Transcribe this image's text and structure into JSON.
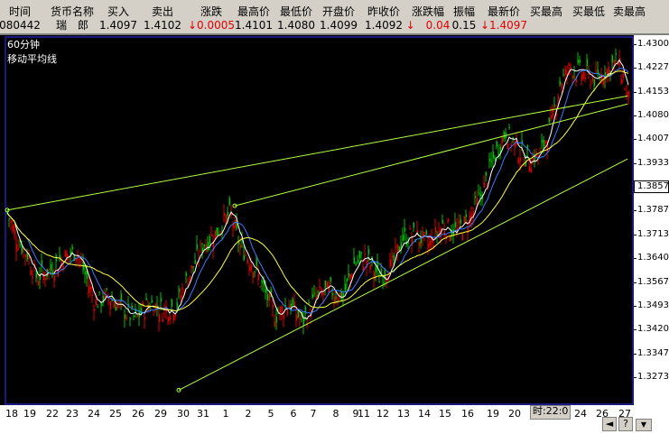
{
  "header": {
    "columns": [
      {
        "label": "时间",
        "value": "080442",
        "red": false
      },
      {
        "label": "货币名称",
        "value": "瑞　郎",
        "red": false
      },
      {
        "label": "买入",
        "value": "1.4097",
        "red": false
      },
      {
        "label": "卖出",
        "value": "1.4102",
        "red": false
      },
      {
        "label": "涨跌",
        "value": "↓0.0005",
        "red": true
      },
      {
        "label": "最高价",
        "value": "1.4101",
        "red": false
      },
      {
        "label": "最低价",
        "value": "1.4080",
        "red": false
      },
      {
        "label": "开盘价",
        "value": "1.4099",
        "red": false
      },
      {
        "label": "昨收价",
        "value": "1.4092",
        "red": false
      },
      {
        "label": "涨跌幅",
        "value": "↓　0.04",
        "red": true
      },
      {
        "label": "振幅",
        "value": "0.15",
        "red": false
      },
      {
        "label": "最新价",
        "value": "↓1.4097",
        "red": true
      },
      {
        "label": "买最高",
        "value": "",
        "red": false
      },
      {
        "label": "买最低",
        "value": "",
        "red": false
      },
      {
        "label": "卖最高",
        "value": "",
        "red": false
      }
    ]
  },
  "chart": {
    "period_label": "60分钟",
    "indicator_label": "移动平均线",
    "current_price": "1.3857",
    "time_readout": "时:22:0",
    "price_ticks": [
      "1.4300",
      "1.4227",
      "1.4153",
      "1.4080",
      "1.4007",
      "1.3933",
      "1.3857",
      "1.3787",
      "1.3713",
      "1.3640",
      "1.3567",
      "1.3493",
      "1.3420",
      "1.3347",
      "1.3273"
    ],
    "date_ticks": [
      "18",
      "19",
      "22",
      "23",
      "24",
      "25",
      "26",
      "29",
      "30",
      "31",
      "1",
      "2",
      "5",
      "6",
      "7",
      "8",
      "9",
      "11",
      "12",
      "13",
      "14",
      "15",
      "16",
      "19",
      "20",
      "23",
      "24",
      "26",
      "27"
    ],
    "colors": {
      "up": "#e00000",
      "down": "#00c000",
      "ma_fast": "#ffffff",
      "ma_mid": "#3a7cff",
      "ma_slow": "#ffff40",
      "trendline": "#b0ff40",
      "frame": "#3030ff"
    }
  },
  "chart_data": {
    "type": "candlestick",
    "ylim": [
      1.3273,
      1.43
    ],
    "x_ticks": [
      "18",
      "19",
      "22",
      "23",
      "24",
      "25",
      "26",
      "29",
      "30",
      "31",
      "1",
      "2",
      "5",
      "6",
      "7",
      "8",
      "9",
      "11",
      "12",
      "13",
      "14",
      "15",
      "16",
      "19",
      "20",
      "23",
      "24",
      "26",
      "27"
    ],
    "close_path": [
      [
        0,
        1.372
      ],
      [
        8,
        1.378
      ],
      [
        18,
        1.37
      ],
      [
        30,
        1.365
      ],
      [
        40,
        1.358
      ],
      [
        55,
        1.36
      ],
      [
        70,
        1.364
      ],
      [
        85,
        1.366
      ],
      [
        95,
        1.358
      ],
      [
        105,
        1.35
      ],
      [
        120,
        1.352
      ],
      [
        135,
        1.348
      ],
      [
        150,
        1.345
      ],
      [
        165,
        1.35
      ],
      [
        180,
        1.348
      ],
      [
        195,
        1.349
      ],
      [
        205,
        1.356
      ],
      [
        215,
        1.362
      ],
      [
        225,
        1.368
      ],
      [
        240,
        1.372
      ],
      [
        255,
        1.378
      ],
      [
        265,
        1.368
      ],
      [
        280,
        1.362
      ],
      [
        295,
        1.352
      ],
      [
        305,
        1.346
      ],
      [
        320,
        1.35
      ],
      [
        335,
        1.344
      ],
      [
        350,
        1.352
      ],
      [
        365,
        1.354
      ],
      [
        380,
        1.352
      ],
      [
        392,
        1.362
      ],
      [
        405,
        1.364
      ],
      [
        420,
        1.358
      ],
      [
        435,
        1.362
      ],
      [
        445,
        1.37
      ],
      [
        460,
        1.371
      ],
      [
        475,
        1.368
      ],
      [
        490,
        1.374
      ],
      [
        505,
        1.372
      ],
      [
        520,
        1.376
      ],
      [
        535,
        1.385
      ],
      [
        548,
        1.396
      ],
      [
        560,
        1.403
      ],
      [
        572,
        1.398
      ],
      [
        585,
        1.394
      ],
      [
        598,
        1.396
      ],
      [
        610,
        1.405
      ],
      [
        620,
        1.418
      ],
      [
        632,
        1.423
      ],
      [
        645,
        1.421
      ],
      [
        660,
        1.419
      ],
      [
        672,
        1.422
      ],
      [
        683,
        1.425
      ],
      [
        690,
        1.42
      ],
      [
        695,
        1.413
      ]
    ],
    "series": [
      {
        "name": "MA fast",
        "color": "#ffffff"
      },
      {
        "name": "MA mid",
        "color": "#3a7cff"
      },
      {
        "name": "MA slow",
        "color": "#ffff40"
      }
    ],
    "trendlines": [
      {
        "from": [
          8,
          1.3787
        ],
        "to": [
          695,
          1.414
        ]
      },
      {
        "from": [
          260,
          1.38
        ],
        "to": [
          695,
          1.4115
        ]
      },
      {
        "from": [
          198,
          1.323
        ],
        "to": [
          695,
          1.3945
        ]
      }
    ],
    "current_price": 1.3857
  }
}
